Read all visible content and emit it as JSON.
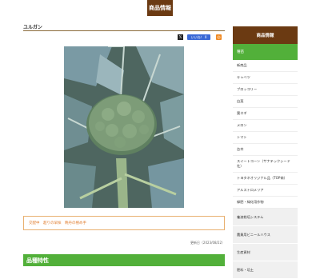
{
  "header": {
    "badge": "商品情報"
  },
  "page": {
    "title": "ユルガン"
  },
  "share": {
    "x_label": "𝕏",
    "fb_label": "いいね！ 0",
    "rss_label": "◎"
  },
  "product": {
    "tags": "交配中　超りの早採　晩丹の極め手",
    "date": "更新日（2023/08/22）"
  },
  "section": {
    "title": "品種特性"
  },
  "sidebar": {
    "title": "商品情報",
    "active": "種苗",
    "subitems": [
      "新商品",
      "キャベツ",
      "ブロッコリー",
      "白菜",
      "葉ネギ",
      "メロン",
      "トマト",
      "台木",
      "スイートコーン（サナテックシード社）",
      "トヨタネオリジナル品（TOP商）",
      "アルストロメリア",
      "緑肥・緑化用作物"
    ],
    "main_items": [
      "養液栽培システム",
      "農業用ビニールハウス",
      "生産資材",
      "肥料・培土"
    ]
  },
  "colors": {
    "brand_brown": "#6b3a12",
    "accent_green": "#52b03a",
    "tag_orange": "#e07a2a"
  }
}
